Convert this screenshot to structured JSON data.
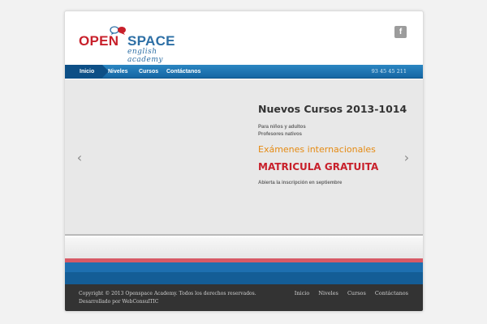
{
  "header": {
    "logo": {
      "word1": "OPEN",
      "word2": "SPACE",
      "tagline": "english academy"
    },
    "social": {
      "facebook_label": "f"
    }
  },
  "nav": {
    "items": [
      {
        "label": "Inicio",
        "active": true
      },
      {
        "label": "Niveles"
      },
      {
        "label": "Cursos"
      },
      {
        "label": "Contáctanos"
      }
    ],
    "phone": "93 45 45 211"
  },
  "slider": {
    "title": "Nuevos Cursos 2013-1014",
    "sub1": "Para niños y adultos",
    "sub2": "Profesores nativos",
    "exams": "Exámenes internacionales",
    "promo": "MATRICULA GRATUITA",
    "open": "Abierta la inscripción en septiembre",
    "prev_icon": "chevron-left-icon",
    "next_icon": "chevron-right-icon"
  },
  "footer": {
    "copyright": "Copyright © 2013 Openspace Academy. Todos los derechos reservados.",
    "developer": "Desarrollado por WebConsulTIC",
    "links": [
      "Inicio",
      "Niveles",
      "Cursos",
      "Contáctanos"
    ]
  },
  "colors": {
    "brand_red": "#c8202b",
    "brand_blue": "#2d6fa5",
    "nav_blue": "#1566a3",
    "accent_orange": "#e58a12",
    "footer_bg": "#333333"
  }
}
